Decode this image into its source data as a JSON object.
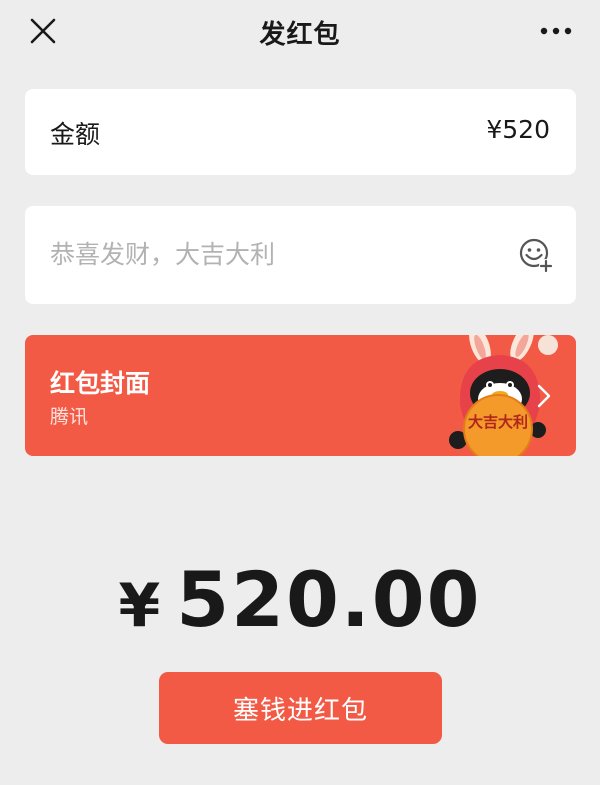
{
  "header": {
    "title": "发红包"
  },
  "amount": {
    "label": "金额",
    "value": "¥520"
  },
  "greeting": {
    "placeholder": "恭喜发财，大吉大利"
  },
  "cover": {
    "title": "红包封面",
    "subtitle": "腾讯",
    "art_text": "大吉大利"
  },
  "total": {
    "currency": "¥",
    "amount": "520.00"
  },
  "submit": {
    "label": "塞钱进红包"
  },
  "colors": {
    "accent": "#f25a46",
    "background": "#ededed",
    "card": "#ffffff"
  },
  "icons": {
    "close": "close-icon",
    "more": "more-icon",
    "emoji": "emoji-add-icon",
    "chevron": "chevron-right-icon"
  }
}
